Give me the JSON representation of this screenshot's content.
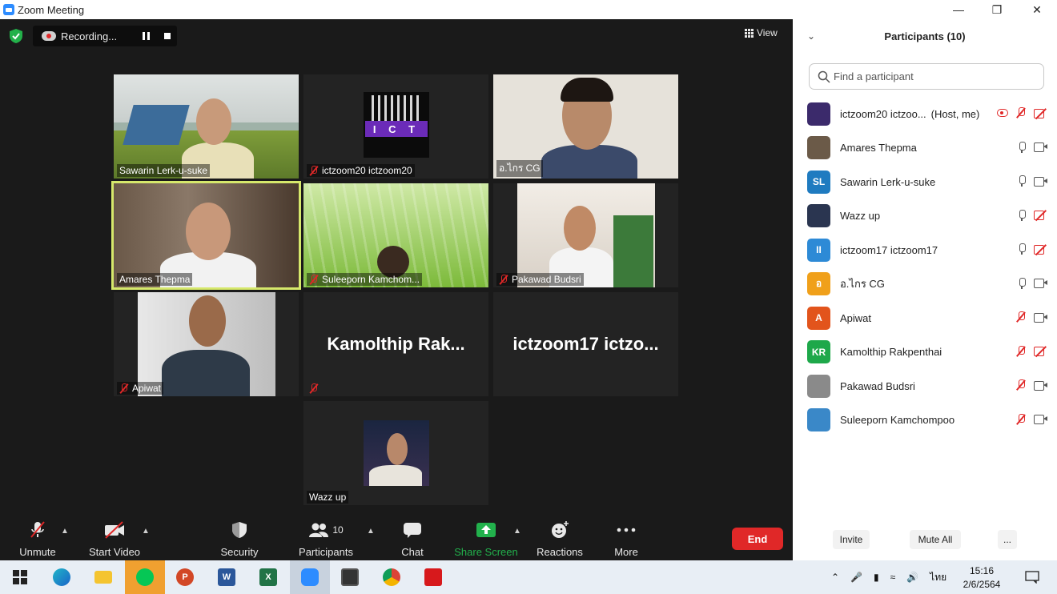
{
  "window": {
    "title": "Zoom Meeting"
  },
  "recording": {
    "label": "Recording..."
  },
  "view_label": "View",
  "tiles": [
    {
      "name": "Sawarin Lerk-u-suke",
      "muted": false
    },
    {
      "name": "ictzoom20 ictzoom20",
      "muted": true
    },
    {
      "name": "อ.ไกร CG",
      "muted": false
    },
    {
      "name": "Amares Thepma",
      "muted": false
    },
    {
      "name": "Suleeporn Kamchom...",
      "muted": true
    },
    {
      "name": "Pakawad Budsri",
      "muted": true
    },
    {
      "name": "Apiwat",
      "muted": true
    },
    {
      "name": "",
      "big_name": "Kamolthip  Rak...",
      "muted": true
    },
    {
      "name": "",
      "big_name": "ictzoom17  ictzo...",
      "muted": false
    },
    {
      "name": "Wazz up",
      "muted": false
    }
  ],
  "ict_logo": {
    "text": "I C T"
  },
  "toolbar": {
    "unmute": "Unmute",
    "start_video": "Start Video",
    "security": "Security",
    "participants": "Participants",
    "participants_count": "10",
    "chat": "Chat",
    "share_screen": "Share Screen",
    "reactions": "Reactions",
    "more": "More",
    "end": "End"
  },
  "panel": {
    "title": "Participants (10)",
    "search_placeholder": "Find a participant",
    "invite": "Invite",
    "mute_all": "Mute All",
    "more": "..."
  },
  "participants": [
    {
      "name": "ictzoom20 ictzoo...",
      "note": "(Host, me)",
      "avatar": "",
      "avatar_color": "#3b2a6b",
      "mic": "off",
      "cam": "off",
      "rec": true
    },
    {
      "name": "Amares Thepma",
      "note": "",
      "avatar": "",
      "avatar_color": "#6b5a48",
      "mic": "on",
      "cam": "on",
      "rec": false
    },
    {
      "name": "Sawarin Lerk-u-suke",
      "note": "",
      "avatar": "SL",
      "avatar_color": "#1f7bc0",
      "mic": "on",
      "cam": "on",
      "rec": false
    },
    {
      "name": "Wazz up",
      "note": "",
      "avatar": "",
      "avatar_color": "#2a3550",
      "mic": "on",
      "cam": "off",
      "rec": false
    },
    {
      "name": "ictzoom17 ictzoom17",
      "note": "",
      "avatar": "II",
      "avatar_color": "#2d8ad6",
      "mic": "on",
      "cam": "off",
      "rec": false
    },
    {
      "name": "อ.ไกร CG",
      "note": "",
      "avatar": "อ",
      "avatar_color": "#f0a01a",
      "mic": "on",
      "cam": "on",
      "rec": false
    },
    {
      "name": "Apiwat",
      "note": "",
      "avatar": "A",
      "avatar_color": "#e2541c",
      "mic": "off",
      "cam": "on",
      "rec": false
    },
    {
      "name": "Kamolthip Rakpenthai",
      "note": "",
      "avatar": "KR",
      "avatar_color": "#1ea84a",
      "mic": "off",
      "cam": "off",
      "rec": false
    },
    {
      "name": "Pakawad Budsri",
      "note": "",
      "avatar": "",
      "avatar_color": "#8a8a8a",
      "mic": "off",
      "cam": "on",
      "rec": false
    },
    {
      "name": "Suleeporn Kamchompoo",
      "note": "",
      "avatar": "",
      "avatar_color": "#3a88c8",
      "mic": "off",
      "cam": "on",
      "rec": false
    }
  ],
  "taskbar": {
    "time": "15:16",
    "date": "2/6/2564",
    "language": "ไทย"
  },
  "colors": {
    "accent": "#2d8cff",
    "end": "#e02828",
    "share": "#22b14c",
    "active_speaker": "#d6e86b"
  }
}
